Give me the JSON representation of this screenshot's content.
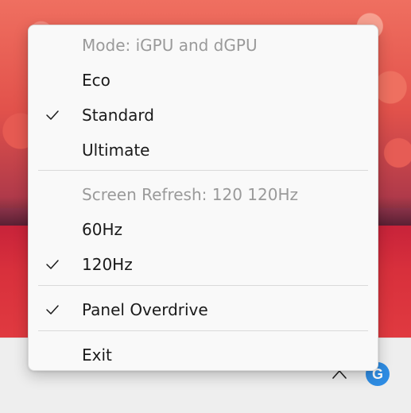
{
  "menu": {
    "items": [
      {
        "label": "Mode: iGPU and dGPU",
        "enabled": false,
        "checked": false
      },
      {
        "label": "Eco",
        "enabled": true,
        "checked": false
      },
      {
        "label": "Standard",
        "enabled": true,
        "checked": true
      },
      {
        "label": "Ultimate",
        "enabled": true,
        "checked": false
      },
      {
        "label": "Screen Refresh: 120 120Hz",
        "enabled": false,
        "checked": false
      },
      {
        "label": "60Hz",
        "enabled": true,
        "checked": false
      },
      {
        "label": "120Hz",
        "enabled": true,
        "checked": true
      },
      {
        "label": "Panel Overdrive",
        "enabled": true,
        "checked": true
      },
      {
        "label": "Exit",
        "enabled": true,
        "checked": false
      }
    ]
  },
  "taskbar": {
    "chevron_icon": "chevron-up-icon",
    "tray_app_icon": "g-helper-icon",
    "tray_app_letter": "G",
    "tray_app_color": "#2f8de4"
  }
}
